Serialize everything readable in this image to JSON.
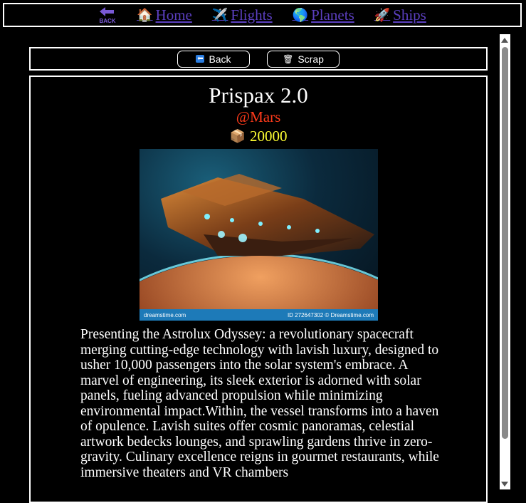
{
  "nav": {
    "back_text": "BACK",
    "items": [
      {
        "icon": "🏠",
        "label": "Home"
      },
      {
        "icon": "✈️",
        "label": "Flights"
      },
      {
        "icon": "🌎",
        "label": "Planets"
      },
      {
        "icon": "🚀",
        "label": "Ships"
      }
    ]
  },
  "actions": {
    "back_label": "Back",
    "back_icon": "⬅",
    "scrap_label": "Scrap",
    "scrap_icon": "🗑"
  },
  "ship": {
    "name": "Prispax 2.0",
    "location": "@Mars",
    "cost": "20000",
    "cost_icon": "📦",
    "image": {
      "watermark": "dreamstime.com",
      "id_text": "ID 272647302 © Dreamstime.com"
    },
    "description": "Presenting the Astrolux Odyssey: a revolutionary spacecraft merging cutting-edge technology with lavish luxury, designed to usher 10,000 passengers into the solar system's embrace. A marvel of engineering, its sleek exterior is adorned with solar panels, fueling advanced propulsion while minimizing environmental impact.Within, the vessel transforms into a haven of opulence. Lavish suites offer cosmic panoramas, celestial artwork bedecks lounges, and sprawling gardens thrive in zero-gravity. Culinary excellence reigns in gourmet restaurants, while immersive theaters and VR chambers"
  },
  "colors": {
    "link": "#5b3fbf",
    "location": "#ff3a1a",
    "cost": "#ffff33",
    "background": "#000000"
  }
}
